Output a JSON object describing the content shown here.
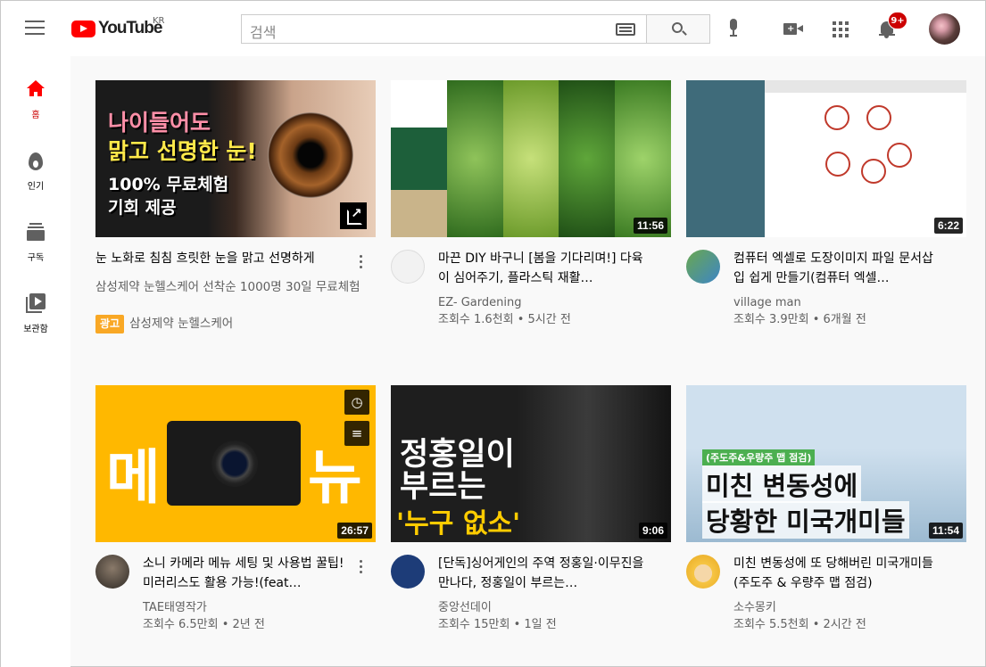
{
  "header": {
    "logo_text": "YouTube",
    "region": "KR",
    "search_placeholder": "검색",
    "notification_count": "9+"
  },
  "sidebar": {
    "items": [
      {
        "label": "홈",
        "icon": "home-icon",
        "active": true
      },
      {
        "label": "인기",
        "icon": "fire-icon"
      },
      {
        "label": "구독",
        "icon": "subscriptions-icon"
      },
      {
        "label": "보관함",
        "icon": "library-icon"
      }
    ]
  },
  "videos": [
    {
      "title": "눈 노화로 침침 흐릿한 눈을 맑고 선명하게",
      "description": "삼성제약 눈헬스케어 선착순 1000명 30일 무료체험",
      "ad_label": "광고",
      "channel": "삼성제약 눈헬스케어",
      "thumb_text": [
        "나이들어도",
        "맑고 선명한 눈!",
        "100% 무료체험",
        "기회 제공"
      ]
    },
    {
      "title": "마끈 DIY 바구니 [봄을 기다리며!] 다육이 심어주기, 플라스틱 재활…",
      "channel": "EZ- Gardening",
      "stats": "조회수 1.6천회 • 5시간 전",
      "duration": "11:56"
    },
    {
      "title": "컴퓨터 엑셀로 도장이미지 파일 문서삽입 쉽게 만들기(컴퓨터 엑셀…",
      "channel": "village man",
      "stats": "조회수 3.9만회 • 6개월 전",
      "duration": "6:22"
    },
    {
      "title": "소니 카메라 메뉴 세팅 및 사용법 꿀팁! 미러리스도 활용 가능!(feat…",
      "channel": "TAE태영작가",
      "stats": "조회수 6.5만회 • 2년 전",
      "duration": "26:57",
      "thumb_text": [
        "메",
        "뉴"
      ]
    },
    {
      "title": "[단독]싱어게인의 주역 정홍일·이무진을 만나다, 정홍일이 부르는…",
      "channel": "중앙선데이",
      "stats": "조회수 15만회 • 1일 전",
      "duration": "9:06",
      "thumb_text": [
        "정홍일이",
        "부르는",
        "'누구 없소'"
      ]
    },
    {
      "title": "미친 변동성에 또 당해버린 미국개미들(주도주 & 우량주 맵 점검)",
      "channel": "소수몽키",
      "stats": "조회수 5.5천회 • 2시간 전",
      "duration": "11:54",
      "thumb_text": [
        "(주도주&우량주 맵 점검)",
        "미친 변동성에",
        "당황한 미국개미들"
      ]
    }
  ],
  "colors": {
    "brand_red": "#ff0000",
    "ad_badge": "#f9a825",
    "text_secondary": "#606060"
  }
}
